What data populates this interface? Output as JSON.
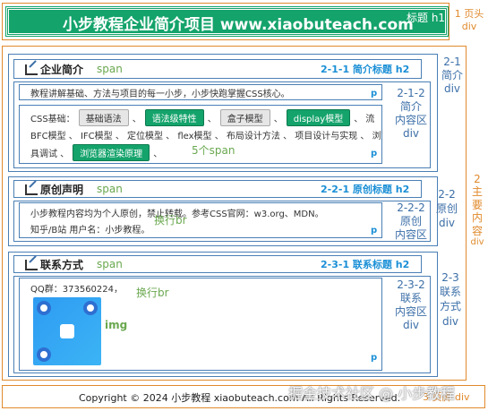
{
  "header": {
    "title": "小步教程企业简介项目 www.xiaobuteach.com",
    "title_annotation": "标题 h1",
    "div_annotation_line1": "1 页头",
    "div_annotation_line2": "div"
  },
  "main": {
    "annotation": [
      "2",
      "主",
      "要",
      "内",
      "容",
      "div"
    ],
    "sections": [
      {
        "title": "企业简介",
        "span_annotation": "span",
        "h2_annotation": "2-1-1 简介标题 h2",
        "div_annotation": [
          "2-1",
          "简介",
          "div"
        ],
        "content_annotation": [
          "2-1-2",
          "简介",
          "内容区",
          "div"
        ],
        "p1": "教程讲解基础、方法与项目的每一小步，小步快跑掌握CSS核心。",
        "p1_annotation": "p",
        "p2_prefix": "CSS基础：",
        "tags": [
          {
            "label": "基础语法",
            "style": "gray"
          },
          {
            "label": "语法级特性",
            "style": "green"
          },
          {
            "label": "盒子模型",
            "style": "gray"
          },
          {
            "label": "display模型",
            "style": "green"
          },
          {
            "label": "流",
            "style": "none"
          }
        ],
        "p2_line2": "BFC模型 、 IFC模型 、 定位模型 、 flex模型 、 布局设计方法 、 项目设计与实现 、 浏览",
        "p2_line3_prefix": "具调试 、",
        "p2_line3_tag": "浏览器渲染原理",
        "span_count_annotation": "5个span",
        "p2_annotation": "p"
      },
      {
        "title": "原创声明",
        "span_annotation": "span",
        "h2_annotation": "2-2-1 原创标题 h2",
        "div_annotation": [
          "2-2",
          "原创",
          "div"
        ],
        "content_annotation": [
          "2-2-2",
          "原创",
          "内容区"
        ],
        "line1": "小步教程内容均为个人原创，禁止转载。参考CSS官网：w3.org、MDN。",
        "line2": "知乎/B站 用户名：小步教程。",
        "br_annotation": "换行br",
        "p_annotation": "p"
      },
      {
        "title": "联系方式",
        "span_annotation": "span",
        "h2_annotation": "2-3-1 联系标题 h2",
        "div_annotation": [
          "2-3",
          "联系",
          "方式",
          "div"
        ],
        "content_annotation": [
          "2-3-2",
          "联系",
          "内容区",
          "div"
        ],
        "line1": "QQ群：373560224，",
        "br_annotation": "换行br",
        "img_annotation": "img",
        "p_annotation": "p"
      }
    ]
  },
  "footer": {
    "text": "Copyright © 2024 小步教程 xiaobuteach.com All Rights Reserved.",
    "annotation": "3 页脚 div",
    "watermark": "掘金技术社区 @ 小步教程"
  }
}
